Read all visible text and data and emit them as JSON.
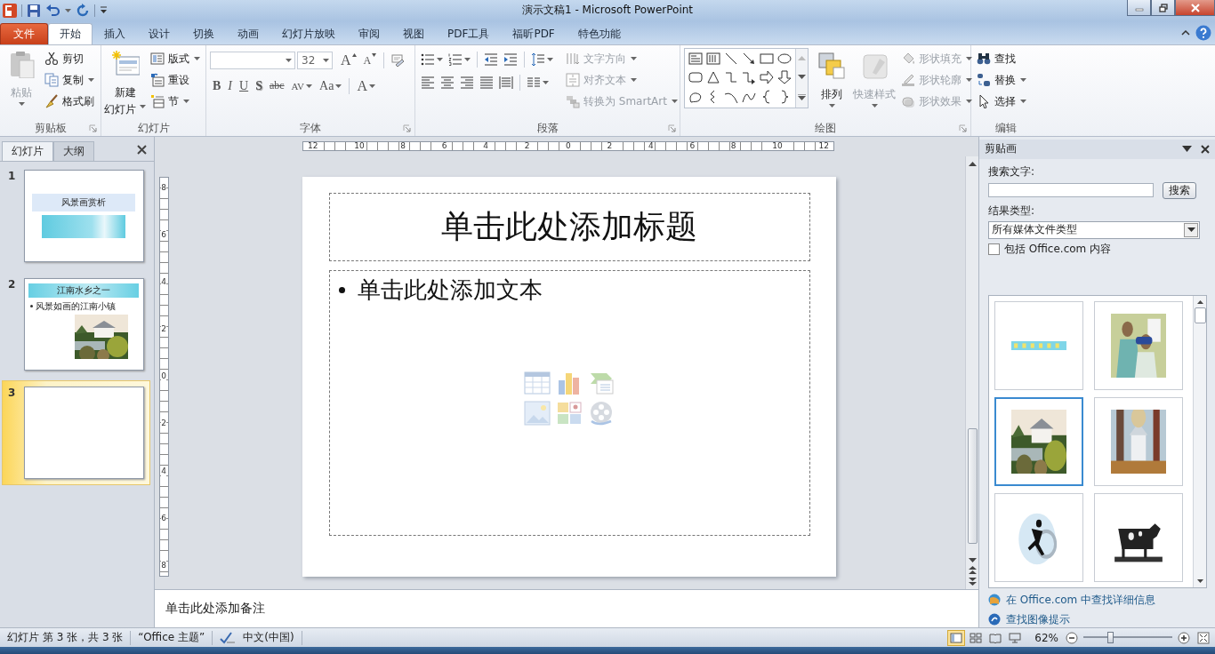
{
  "window": {
    "title": "演示文稿1 - Microsoft PowerPoint"
  },
  "ribbon_tabs": [
    {
      "label": "文件",
      "kind": "file",
      "selected": false
    },
    {
      "label": "开始",
      "kind": "tab",
      "selected": true
    },
    {
      "label": "插入",
      "kind": "tab",
      "selected": false
    },
    {
      "label": "设计",
      "kind": "tab",
      "selected": false
    },
    {
      "label": "切换",
      "kind": "tab",
      "selected": false
    },
    {
      "label": "动画",
      "kind": "tab",
      "selected": false
    },
    {
      "label": "幻灯片放映",
      "kind": "tab",
      "selected": false
    },
    {
      "label": "审阅",
      "kind": "tab",
      "selected": false
    },
    {
      "label": "视图",
      "kind": "tab",
      "selected": false
    },
    {
      "label": "PDF工具",
      "kind": "tab",
      "selected": false
    },
    {
      "label": "福昕PDF",
      "kind": "tab",
      "selected": false
    },
    {
      "label": "特色功能",
      "kind": "tab",
      "selected": false
    }
  ],
  "ribbon_groups": [
    {
      "kind": "clipboard",
      "label": "剪贴板",
      "launcher": true,
      "items": [
        {
          "label": "粘贴",
          "disabled": true,
          "dropdown": true
        },
        {
          "label": "剪切",
          "disabled": false,
          "dropdown": false
        },
        {
          "label": "复制",
          "disabled": false,
          "dropdown": true
        },
        {
          "label": "格式刷",
          "disabled": false,
          "dropdown": false
        }
      ]
    },
    {
      "kind": "slides",
      "label": "幻灯片",
      "launcher": false,
      "items": [
        {
          "label": "新建",
          "label_2": "幻灯片",
          "disabled": false,
          "dropdown": true
        },
        {
          "label": "版式",
          "disabled": false,
          "dropdown": true
        },
        {
          "label": "重设",
          "disabled": false,
          "dropdown": false
        },
        {
          "label": "节",
          "disabled": false,
          "dropdown": true
        }
      ]
    },
    {
      "kind": "font",
      "label": "字体",
      "launcher": true,
      "font_size": "32",
      "buttons": [
        {
          "kind": "grow",
          "glyph": "A",
          "dropdown": false
        },
        {
          "kind": "shrink",
          "glyph": "A",
          "dropdown": false
        },
        {
          "kind": "bold",
          "glyph": "B",
          "dropdown": false
        },
        {
          "kind": "italic",
          "glyph": "I",
          "dropdown": false
        },
        {
          "kind": "underline",
          "glyph": "U",
          "dropdown": false
        },
        {
          "kind": "shadow",
          "glyph": "S",
          "dropdown": false
        },
        {
          "kind": "strike",
          "glyph": "abc",
          "dropdown": false
        },
        {
          "kind": "spacing",
          "glyph": "AV",
          "dropdown": true
        },
        {
          "kind": "case",
          "glyph": "Aa",
          "dropdown": true
        },
        {
          "kind": "color",
          "glyph": "A",
          "dropdown": true
        }
      ]
    },
    {
      "kind": "paragraph",
      "label": "段落",
      "launcher": true,
      "items": [
        {
          "label": "文字方向",
          "disabled": true,
          "dropdown": true
        },
        {
          "label": "对齐文本",
          "disabled": true,
          "dropdown": true
        },
        {
          "label": "转换为 SmartArt",
          "disabled": true,
          "dropdown": true
        }
      ]
    },
    {
      "kind": "drawing",
      "label": "绘图",
      "launcher": true,
      "items": [
        {
          "label": "排列",
          "disabled": false,
          "dropdown": true
        },
        {
          "label": "快速样式",
          "disabled": true,
          "dropdown": true
        },
        {
          "label": "形状填充",
          "disabled": true,
          "dropdown": true
        },
        {
          "label": "形状轮廓",
          "disabled": true,
          "dropdown": true
        },
        {
          "label": "形状效果",
          "disabled": true,
          "dropdown": true
        }
      ]
    },
    {
      "kind": "editing",
      "label": "编辑",
      "launcher": false,
      "items": [
        {
          "label": "查找",
          "disabled": false,
          "dropdown": false
        },
        {
          "label": "替换",
          "disabled": false,
          "dropdown": true
        },
        {
          "label": "选择",
          "disabled": false,
          "dropdown": true
        }
      ]
    }
  ],
  "slide_panel": {
    "tabs": [
      {
        "label": "幻灯片",
        "selected": true
      },
      {
        "label": "大纲",
        "selected": false
      }
    ],
    "slides": [
      {
        "number": "1",
        "kind": "title",
        "selected": false,
        "title": "风景画赏析"
      },
      {
        "number": "2",
        "kind": "content",
        "selected": false,
        "title": "江南水乡之一",
        "bullet": "风景如画的江南小镇"
      },
      {
        "number": "3",
        "kind": "blank",
        "selected": true
      }
    ]
  },
  "rulers": {
    "horizontal": [
      "12",
      "10",
      "8",
      "6",
      "4",
      "2",
      "0",
      "2",
      "4",
      "6",
      "8",
      "10",
      "12"
    ],
    "vertical": [
      "8",
      "6",
      "4",
      "2",
      "0",
      "2",
      "4",
      "6",
      "8"
    ]
  },
  "slide": {
    "title_placeholder": "单击此处添加标题",
    "body_placeholder": "单击此处添加文本"
  },
  "notes": {
    "placeholder": "单击此处添加备注"
  },
  "clip_pane": {
    "title": "剪贴画",
    "search_label": "搜索文字:",
    "search_button": "搜索",
    "type_label": "结果类型:",
    "type_value": "所有媒体文件类型",
    "include_label": "包括 Office.com 内容",
    "include_checked": false,
    "results": [
      {
        "kind": "picture",
        "selected": false
      },
      {
        "kind": "picture",
        "selected": false
      },
      {
        "kind": "picture",
        "selected": true
      },
      {
        "kind": "picture",
        "selected": false
      },
      {
        "kind": "picture",
        "selected": false
      },
      {
        "kind": "picture",
        "selected": false
      }
    ],
    "links": [
      "在 Office.com 中查找详细信息",
      "查找图像提示"
    ]
  },
  "status": {
    "slide_info": "幻灯片 第 3 张，共 3 张",
    "theme": "“Office 主题”",
    "language": "中文(中国)",
    "views": [
      {
        "selected": true
      },
      {
        "selected": false
      },
      {
        "selected": false
      },
      {
        "selected": false
      }
    ],
    "zoom": "62%",
    "zoom_slider": {
      "level": 0.3
    }
  }
}
